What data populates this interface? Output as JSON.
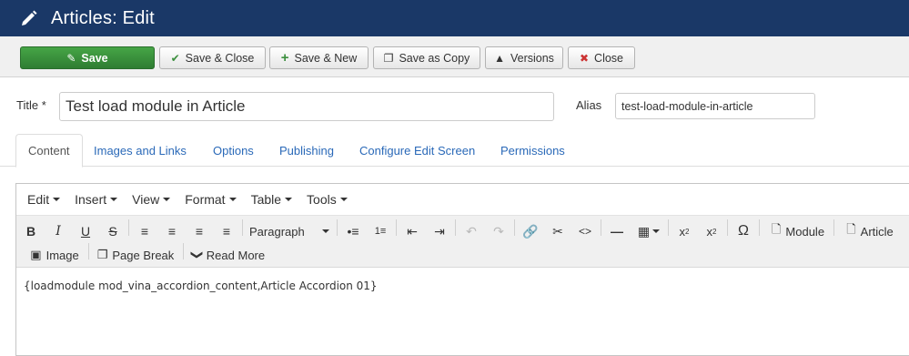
{
  "header": {
    "title": "Articles: Edit",
    "icon": "pencil-icon"
  },
  "toolbar": {
    "save": "Save",
    "save_close": "Save & Close",
    "save_new": "Save & New",
    "save_copy": "Save as Copy",
    "versions": "Versions",
    "close": "Close"
  },
  "form": {
    "title_label": "Title *",
    "title_value": "Test load module in Article",
    "alias_label": "Alias",
    "alias_value": "test-load-module-in-article"
  },
  "tabs": [
    "Content",
    "Images and Links",
    "Options",
    "Publishing",
    "Configure Edit Screen",
    "Permissions"
  ],
  "editor": {
    "menus": [
      "Edit",
      "Insert",
      "View",
      "Format",
      "Table",
      "Tools"
    ],
    "format_select": "Paragraph",
    "module_btn": "Module",
    "article_btn": "Article",
    "image_btn": "Image",
    "pagebreak_btn": "Page Break",
    "readmore_btn": "Read More",
    "body": "{loadmodule mod_vina_accordion_content,Article Accordion 01}"
  },
  "colors": {
    "header_bg": "#1a3867",
    "save_green": "#3c8f3e",
    "link_blue": "#2a69b8"
  }
}
